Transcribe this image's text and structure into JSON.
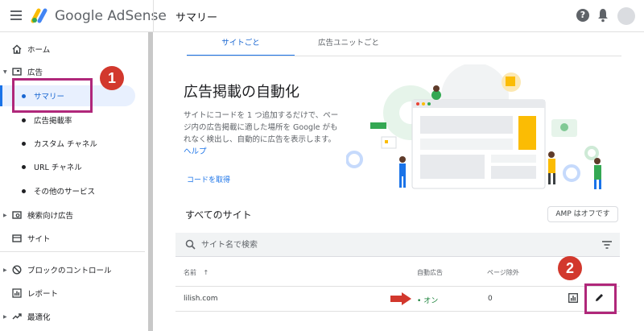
{
  "header": {
    "brand": "Google AdSense",
    "page_title": "サマリー",
    "help_symbol": "?"
  },
  "sidebar": {
    "items": [
      {
        "label": "ホーム",
        "icon": "home-icon"
      },
      {
        "label": "広告",
        "icon": "ads-icon"
      },
      {
        "label": "サマリー",
        "icon": "dot",
        "active": true
      },
      {
        "label": "広告掲載率",
        "icon": "dot"
      },
      {
        "label": "カスタム チャネル",
        "icon": "dot"
      },
      {
        "label": "URL チャネル",
        "icon": "dot"
      },
      {
        "label": "その他のサービス",
        "icon": "dot"
      },
      {
        "label": "検索向け広告",
        "icon": "search-ads-icon"
      },
      {
        "label": "サイト",
        "icon": "sites-icon"
      },
      {
        "label": "ブロックのコントロール",
        "icon": "block-icon"
      },
      {
        "label": "レポート",
        "icon": "report-icon"
      },
      {
        "label": "最適化",
        "icon": "trend-icon"
      }
    ]
  },
  "annotations": {
    "badge1": "1",
    "badge2": "2"
  },
  "tabs": [
    {
      "label": "サイトごと",
      "active": true
    },
    {
      "label": "広告ユニットごと",
      "active": false
    }
  ],
  "hero": {
    "title": "広告掲載の自動化",
    "description": "サイトにコードを 1 つ追加するだけで、ページ内の広告掲載に適した場所を Google がもれなく検出し、自動的に広告を表示します。",
    "help_link": "ヘルプ",
    "get_code": "コードを取得"
  },
  "sites": {
    "title": "すべてのサイト",
    "amp_button": "AMP はオフです",
    "search_placeholder": "サイト名で検索",
    "columns": {
      "name": "名前",
      "sort_arrow": "↑",
      "auto_ads": "自動広告",
      "page_exclusion": "ページ除外"
    },
    "rows": [
      {
        "name": "lilish.com",
        "auto_ads": "オン",
        "page_exclusion": "0"
      }
    ]
  },
  "colors": {
    "accent": "#1a73e8",
    "highlight": "#b0277a",
    "badge": "#d2382d",
    "status_on": "#188038",
    "arrow": "#d2382d"
  }
}
